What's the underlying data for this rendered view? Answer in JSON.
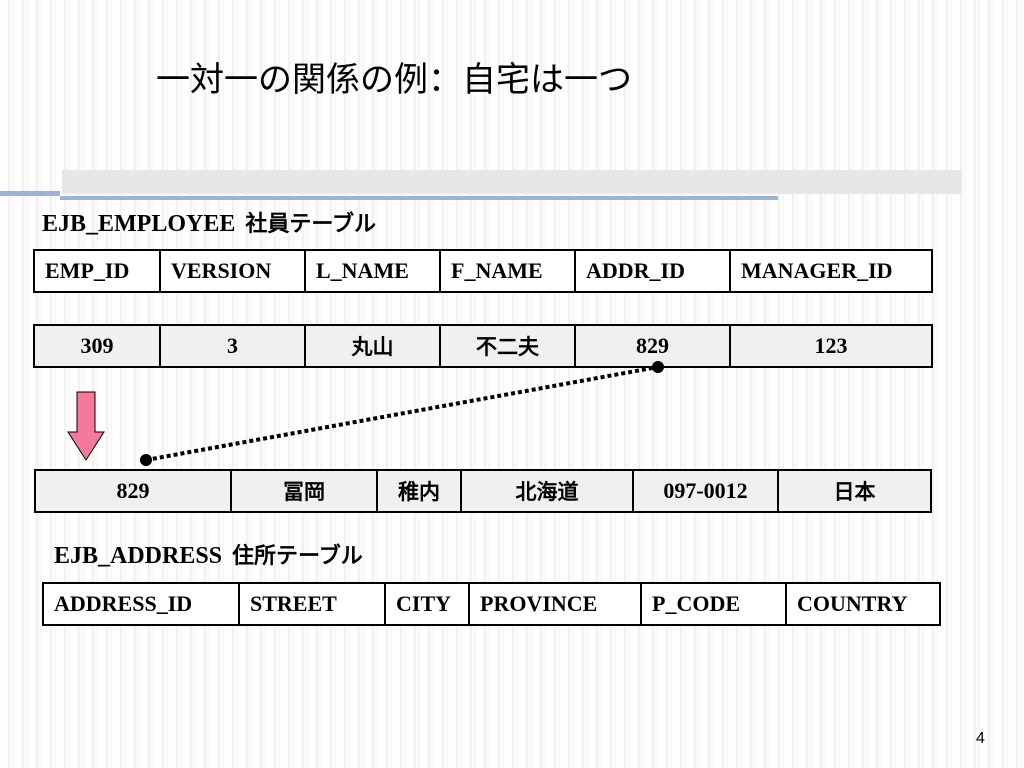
{
  "title": "一対一の関係の例：自宅は一つ",
  "employee_table": {
    "name": "EJB_EMPLOYEE",
    "jp_label": "社員テーブル",
    "columns": [
      "EMP_ID",
      "VERSION",
      "L_NAME",
      "F_NAME",
      "ADDR_ID",
      "MANAGER_ID"
    ],
    "row": [
      "309",
      "3",
      "丸山",
      "不二夫",
      "829",
      "123"
    ]
  },
  "address_table": {
    "name": "EJB_ADDRESS",
    "jp_label": "住所テーブル",
    "columns": [
      "ADDRESS_ID",
      "STREET",
      "CITY",
      "PROVINCE",
      "P_CODE",
      "COUNTRY"
    ],
    "row": [
      "829",
      "冨岡",
      "稚内",
      "北海道",
      "097-0012",
      "日本"
    ]
  },
  "page_number": "4",
  "colors": {
    "arrow_fill": "#f47a9b",
    "band_accent": "#9eb3cf"
  }
}
